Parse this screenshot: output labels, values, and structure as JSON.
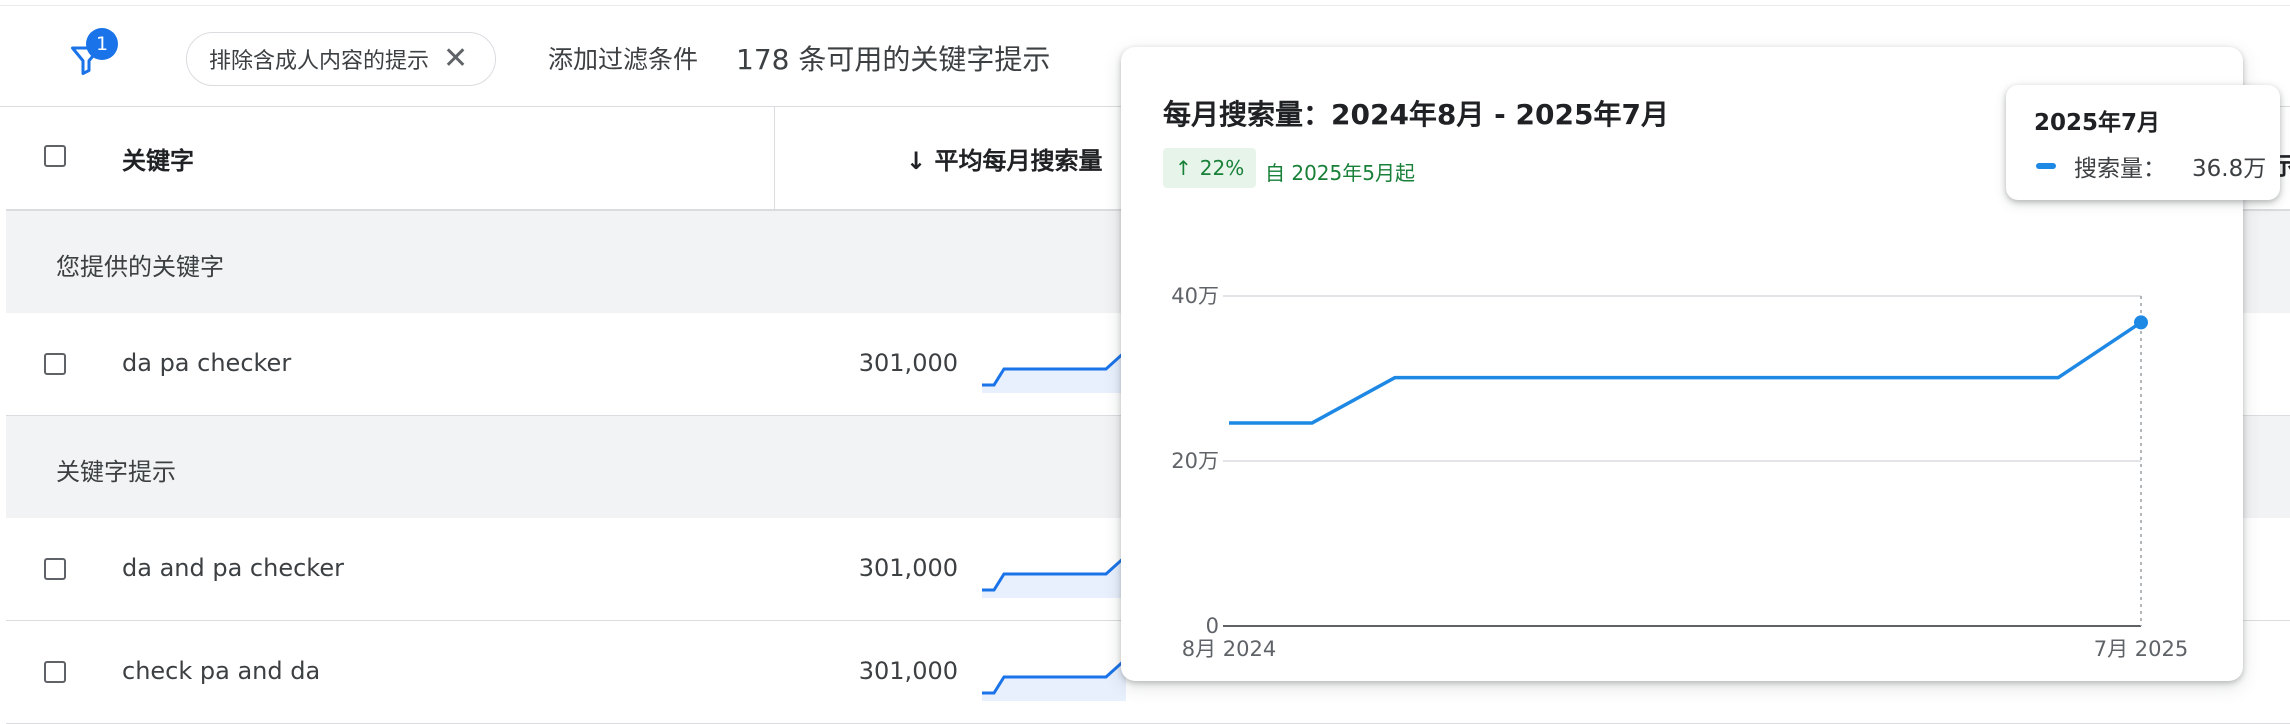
{
  "filter_bar": {
    "badge_count": "1",
    "chip_label": "排除含成人内容的提示",
    "add_filter": "添加过滤条件",
    "available_count": "178 条可用的关键字提示"
  },
  "table": {
    "headers": {
      "keyword": "关键字",
      "avg_monthly": "平均每月搜索量",
      "avg_sort_arrow": "↓"
    },
    "groups": {
      "provided": "您提供的关键字",
      "suggestions": "关键字提示"
    },
    "rows": [
      {
        "keyword": "da pa checker",
        "volume": "301,000"
      },
      {
        "keyword": "da and pa checker",
        "volume": "301,000"
      },
      {
        "keyword": "check pa and da",
        "volume": "301,000"
      }
    ],
    "edge_header_fragment": "示"
  },
  "popup": {
    "title": "每月搜索量：2024年8月 - 2025年7月",
    "trend_arrow": "↑",
    "trend_value": "22%",
    "trend_since": "自 2025年5月起",
    "tooltip": {
      "title": "2025年7月",
      "label": "搜索量：",
      "value": "36.8万"
    }
  },
  "chart_data": {
    "type": "line",
    "x": [
      "2024-08",
      "2024-09",
      "2024-10",
      "2024-11",
      "2024-12",
      "2025-01",
      "2025-02",
      "2025-03",
      "2025-04",
      "2025-05",
      "2025-06",
      "2025-07"
    ],
    "x_tick_labels": [
      "8月 2024",
      "7月 2025"
    ],
    "y_tick_labels": [
      "0",
      "20万",
      "40万"
    ],
    "ylim": [
      0,
      400000
    ],
    "series": [
      {
        "values": [
          246000,
          246000,
          301000,
          301000,
          301000,
          301000,
          301000,
          301000,
          301000,
          301000,
          301000,
          368000
        ],
        "color": "#1e88e5"
      }
    ],
    "grid": true,
    "highlight_index": 11
  },
  "colors": {
    "accent": "#1a73e8",
    "series": "#1e88e5",
    "trend_green": "#188038",
    "trend_bg": "#e6f4ea"
  }
}
